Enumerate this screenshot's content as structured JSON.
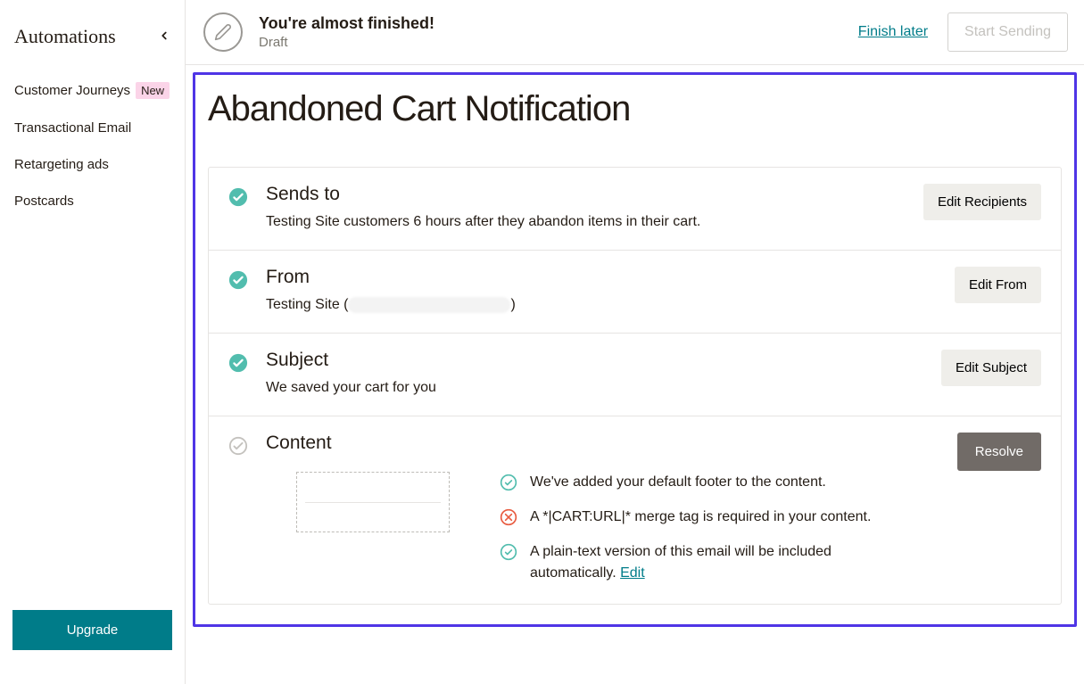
{
  "sidebar": {
    "title": "Automations",
    "items": [
      {
        "label": "Customer Journeys",
        "badge": "New"
      },
      {
        "label": "Transactional Email"
      },
      {
        "label": "Retargeting ads"
      },
      {
        "label": "Postcards"
      }
    ],
    "upgrade_label": "Upgrade"
  },
  "header": {
    "title": "You're almost finished!",
    "status": "Draft",
    "finish_later_label": "Finish later",
    "start_label": "Start Sending"
  },
  "page": {
    "title": "Abandoned Cart Notification"
  },
  "sections": {
    "sends_to": {
      "title": "Sends to",
      "desc": "Testing Site customers 6 hours after they abandon items in their cart.",
      "action": "Edit Recipients"
    },
    "from": {
      "title": "From",
      "desc_prefix": "Testing Site (",
      "desc_suffix": ")",
      "action": "Edit From"
    },
    "subject": {
      "title": "Subject",
      "desc": "We saved your cart for you",
      "action": "Edit Subject"
    },
    "content": {
      "title": "Content",
      "action": "Resolve",
      "messages": {
        "footer": "We've added your default footer to the content.",
        "merge_tag": "A *|CART:URL|* merge tag is required in your content.",
        "plaintext": "A plain-text version of this email will be included automatically. ",
        "edit_label": "Edit"
      }
    }
  }
}
